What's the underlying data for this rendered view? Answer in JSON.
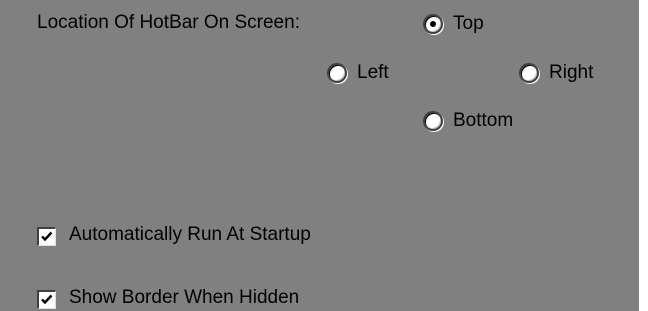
{
  "hotbar_location": {
    "label": "Location Of HotBar On Screen:",
    "selected": "top",
    "options": {
      "top": "Top",
      "left": "Left",
      "right": "Right",
      "bottom": "Bottom"
    }
  },
  "checkboxes": {
    "auto_run": {
      "label": "Automatically Run At Startup",
      "checked": true
    },
    "show_border": {
      "label": "Show Border When Hidden",
      "checked": true
    }
  },
  "colors": {
    "panel_background": "#808080",
    "frame_edge": "#ffffff"
  }
}
